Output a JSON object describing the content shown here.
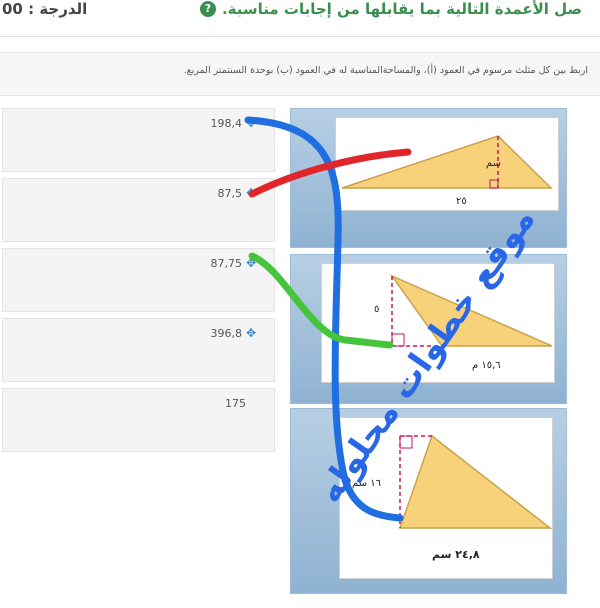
{
  "header": {
    "title": "صل الأعمدة التالية بما يقابلها من إجابات مناسبة.",
    "help_icon": "question-circle-icon",
    "grade": "الدرجة : 00"
  },
  "instruction": "اربط بين كل مثلث مرسوم في العمود (أ)، والمساحةالمناسبة له في العمود (ب) بوحدة السنتمتر المربع.",
  "answers": [
    {
      "value": "198,4",
      "icon": "move-icon"
    },
    {
      "value": "87,5",
      "icon": "move-icon"
    },
    {
      "value": "87,75",
      "icon": "move-icon"
    },
    {
      "value": "396,8",
      "icon": "move-icon"
    },
    {
      "value": "175",
      "icon": ""
    }
  ],
  "triangles": [
    {
      "height_label": "سم",
      "base_label": "٢٥"
    },
    {
      "height_label": "٥",
      "base_label": "١٥,٦ م"
    },
    {
      "height_label": "١٦ سم",
      "base_label": "٢٤,٨ سم"
    }
  ],
  "watermark": "موقع خطوات محلوله",
  "colors": {
    "title_green": "#3a8f4f",
    "blue_line": "#1f6fe0",
    "red_line": "#e0262b",
    "green_line": "#46c43c",
    "watermark_blue": "#2a67e6",
    "card_blue": "#8fb2d2",
    "triangle_fill": "#f7d27a"
  }
}
